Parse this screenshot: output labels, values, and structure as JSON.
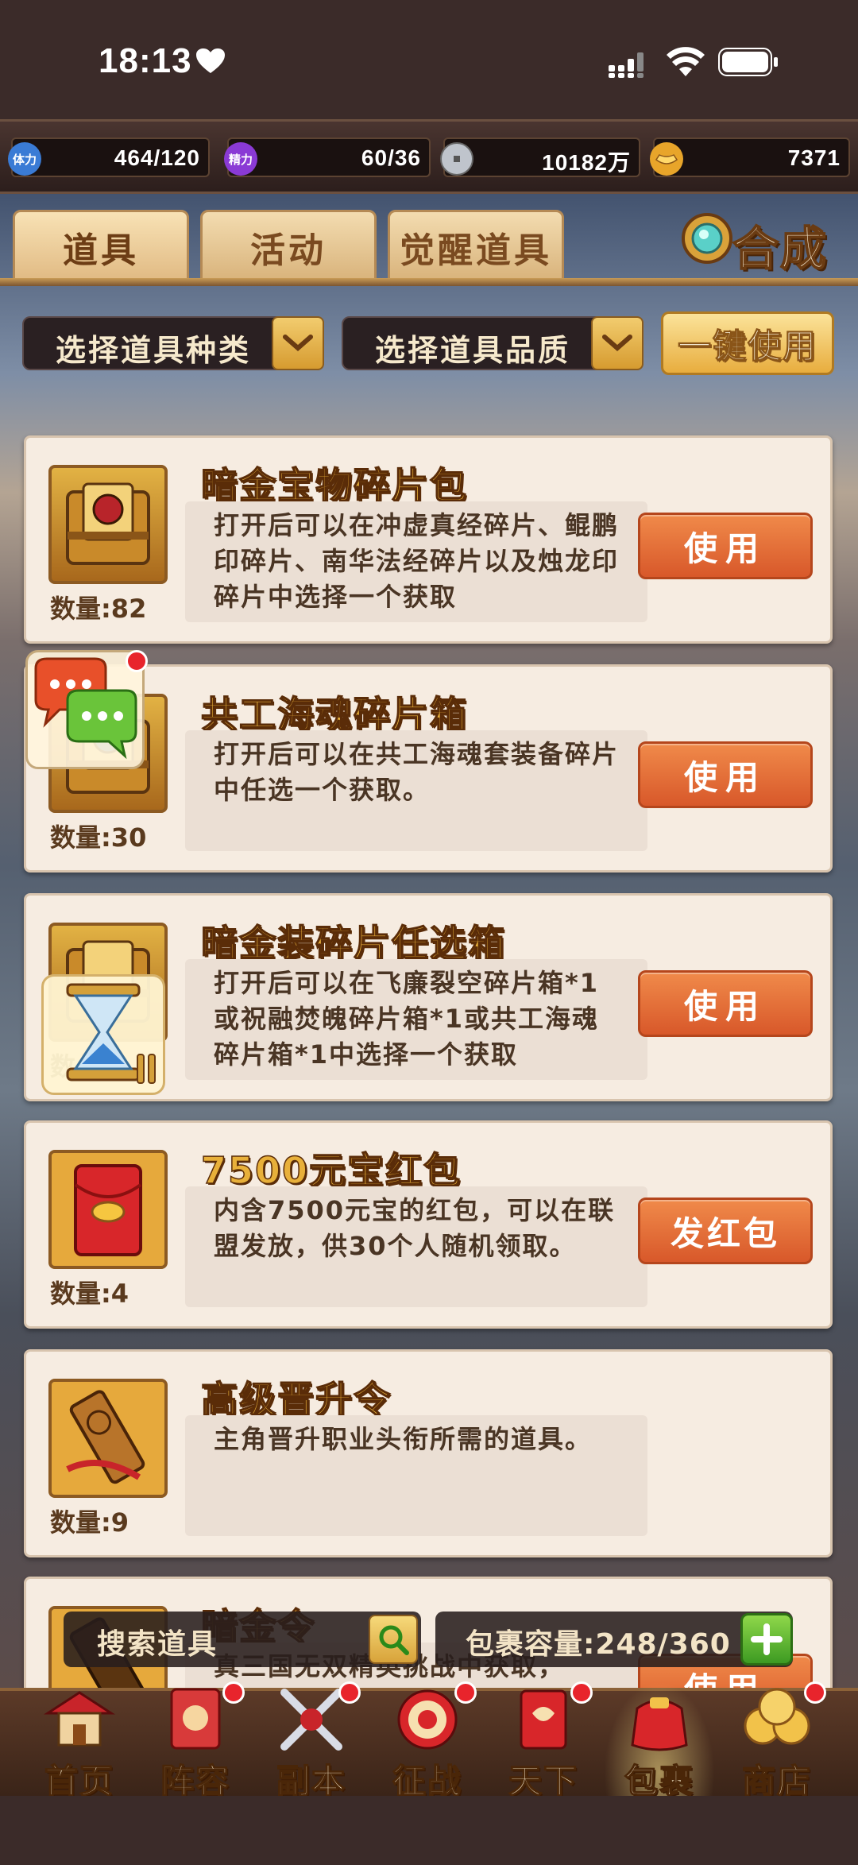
{
  "status_bar": {
    "time": "18:13"
  },
  "resources": {
    "stamina": {
      "icon_text": "体力",
      "value": "464/120",
      "color": "#3a7bd5"
    },
    "energy": {
      "icon_text": "精力",
      "value": "60/36",
      "color": "#8a3ad5"
    },
    "coins": {
      "value": "10182万"
    },
    "gold": {
      "value": "7371"
    }
  },
  "tabs": [
    {
      "label": "道具",
      "active": true
    },
    {
      "label": "活动",
      "active": false
    },
    {
      "label": "觉醒道具",
      "active": false
    }
  ],
  "synth_label": "合成",
  "filters": {
    "type_label": "选择道具种类",
    "quality_label": "选择道具品质",
    "use_all_label": "一键使用"
  },
  "items": [
    {
      "title": "暗金宝物碎片包",
      "desc": "打开后可以在冲虚真经碎片、鲲鹏印碎片、南华法经碎片以及烛龙印碎片中选择一个获取",
      "qty": "数量:82",
      "button": "使用",
      "icon": "chest-icon"
    },
    {
      "title": "共工海魂碎片箱",
      "desc": "打开后可以在共工海魂套装备碎片中任选一个获取。",
      "qty": "数量:30",
      "button": "使用",
      "icon": "chest-icon"
    },
    {
      "title": "暗金装碎片任选箱",
      "desc": "打开后可以在飞廉裂空碎片箱*1或祝融焚魄碎片箱*1或共工海魂碎片箱*1中选择一个获取",
      "qty": "数",
      "button": "使用",
      "icon": "chest-icon"
    },
    {
      "title": "7500元宝红包",
      "desc": "内含7500元宝的红包，可以在联盟发放，供30个人随机领取。",
      "qty": "数量:4",
      "button": "发红包",
      "icon": "red-envelope-icon"
    },
    {
      "title": "高级晋升令",
      "desc": "主角晋升职业头衔所需的道具。",
      "qty": "数量:9",
      "button": "",
      "icon": "token-icon"
    },
    {
      "title": "暗金令",
      "desc": "真三国无双精英挑战中获取，",
      "qty": "",
      "button": "使用",
      "icon": "token-icon"
    }
  ],
  "search": {
    "placeholder": "搜索道具"
  },
  "capacity": {
    "label": "包裹容量:248/360"
  },
  "nav": [
    {
      "label": "首页",
      "badge": false
    },
    {
      "label": "阵容",
      "badge": true
    },
    {
      "label": "副本",
      "badge": true
    },
    {
      "label": "征战",
      "badge": true
    },
    {
      "label": "天下",
      "badge": true
    },
    {
      "label": "包裹",
      "badge": false,
      "active": true
    },
    {
      "label": "商店",
      "badge": true
    }
  ],
  "colors": {
    "card_bg": "#f6ece1",
    "button_orange": "#e06a34",
    "title_gold": "#e8b03a",
    "badge_red": "#e8242c"
  }
}
